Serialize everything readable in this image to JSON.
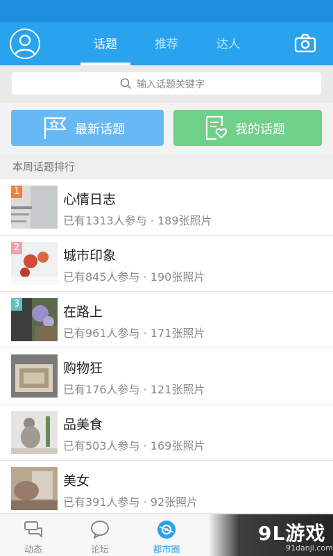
{
  "header": {
    "tabs": [
      {
        "label": "话题",
        "active": true
      },
      {
        "label": "推荐",
        "active": false
      },
      {
        "label": "达人",
        "active": false
      }
    ],
    "icons": {
      "left": "user-avatar-icon",
      "right": "camera-icon"
    }
  },
  "search": {
    "placeholder": "输入话题关键字",
    "icon": "search-icon"
  },
  "actions": {
    "new_label": "最新话题",
    "new_icon": "flag-star-icon",
    "mine_label": "我的话题",
    "mine_icon": "document-heart-icon"
  },
  "section": {
    "title": "本周话题排行"
  },
  "topics": [
    {
      "rank": "1",
      "title": "心情日志",
      "meta": "已有1313人参与 · 189张照片"
    },
    {
      "rank": "2",
      "title": "城市印象",
      "meta": "已有845人参与 · 190张照片"
    },
    {
      "rank": "3",
      "title": "在路上",
      "meta": "已有961人参与 · 171张照片"
    },
    {
      "rank": "",
      "title": "购物狂",
      "meta": "已有176人参与 · 121张照片"
    },
    {
      "rank": "",
      "title": "品美食",
      "meta": "已有503人参与 · 169张照片"
    },
    {
      "rank": "",
      "title": "美女",
      "meta": "已有391人参与 · 92张照片"
    }
  ],
  "nav": {
    "items": [
      {
        "label": "动态",
        "icon": "chat-stack-icon",
        "active": false
      },
      {
        "label": "论坛",
        "icon": "speech-bubble-icon",
        "active": false
      },
      {
        "label": "都市圈",
        "icon": "city-circle-icon",
        "active": true
      }
    ]
  },
  "watermark": {
    "logo": "9L游戏",
    "url": "91danji.com"
  },
  "colors": {
    "accent": "#29a3ee",
    "status_bar": "#1e8fdc",
    "new_button": "#68b9f3",
    "mine_button": "#6fd08a",
    "rank1": "#f0833a",
    "rank2": "#f0a0b0",
    "rank3": "#60c0c0"
  }
}
